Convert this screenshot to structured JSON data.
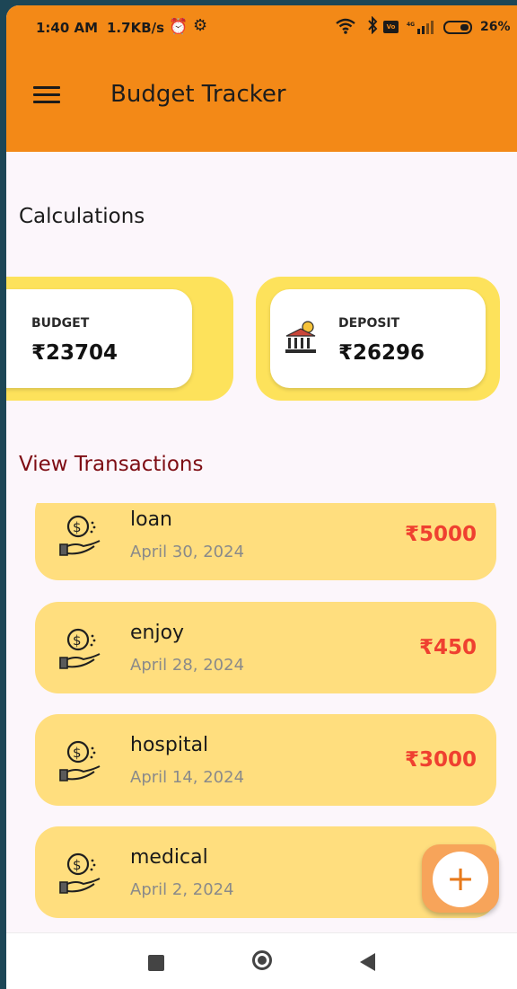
{
  "status_bar": {
    "time": "1:40 AM",
    "net_speed": "1.7KB/s",
    "battery": "26%"
  },
  "app_bar": {
    "title": "Budget Tracker"
  },
  "calculations": {
    "heading": "Calculations",
    "budget": {
      "label": "BUDGET",
      "value": "₹23704"
    },
    "deposit": {
      "label": "DEPOSIT",
      "value": "₹26296"
    }
  },
  "transactions": {
    "heading": "View Transactions",
    "items": [
      {
        "name": "loan",
        "date": "April 30, 2024",
        "amount": "₹5000"
      },
      {
        "name": "enjoy",
        "date": "April 28, 2024",
        "amount": "₹450"
      },
      {
        "name": "hospital",
        "date": "April 14, 2024",
        "amount": "₹3000"
      },
      {
        "name": "medical",
        "date": "April 2, 2024",
        "amount": "₹"
      }
    ]
  },
  "fab": {
    "symbol": "+"
  },
  "colors": {
    "app_bar": "#f38917",
    "card_border": "#fde25b",
    "transaction_bg": "#ffde7e",
    "amount": "#ef4030",
    "view_heading": "#7e0d14"
  }
}
